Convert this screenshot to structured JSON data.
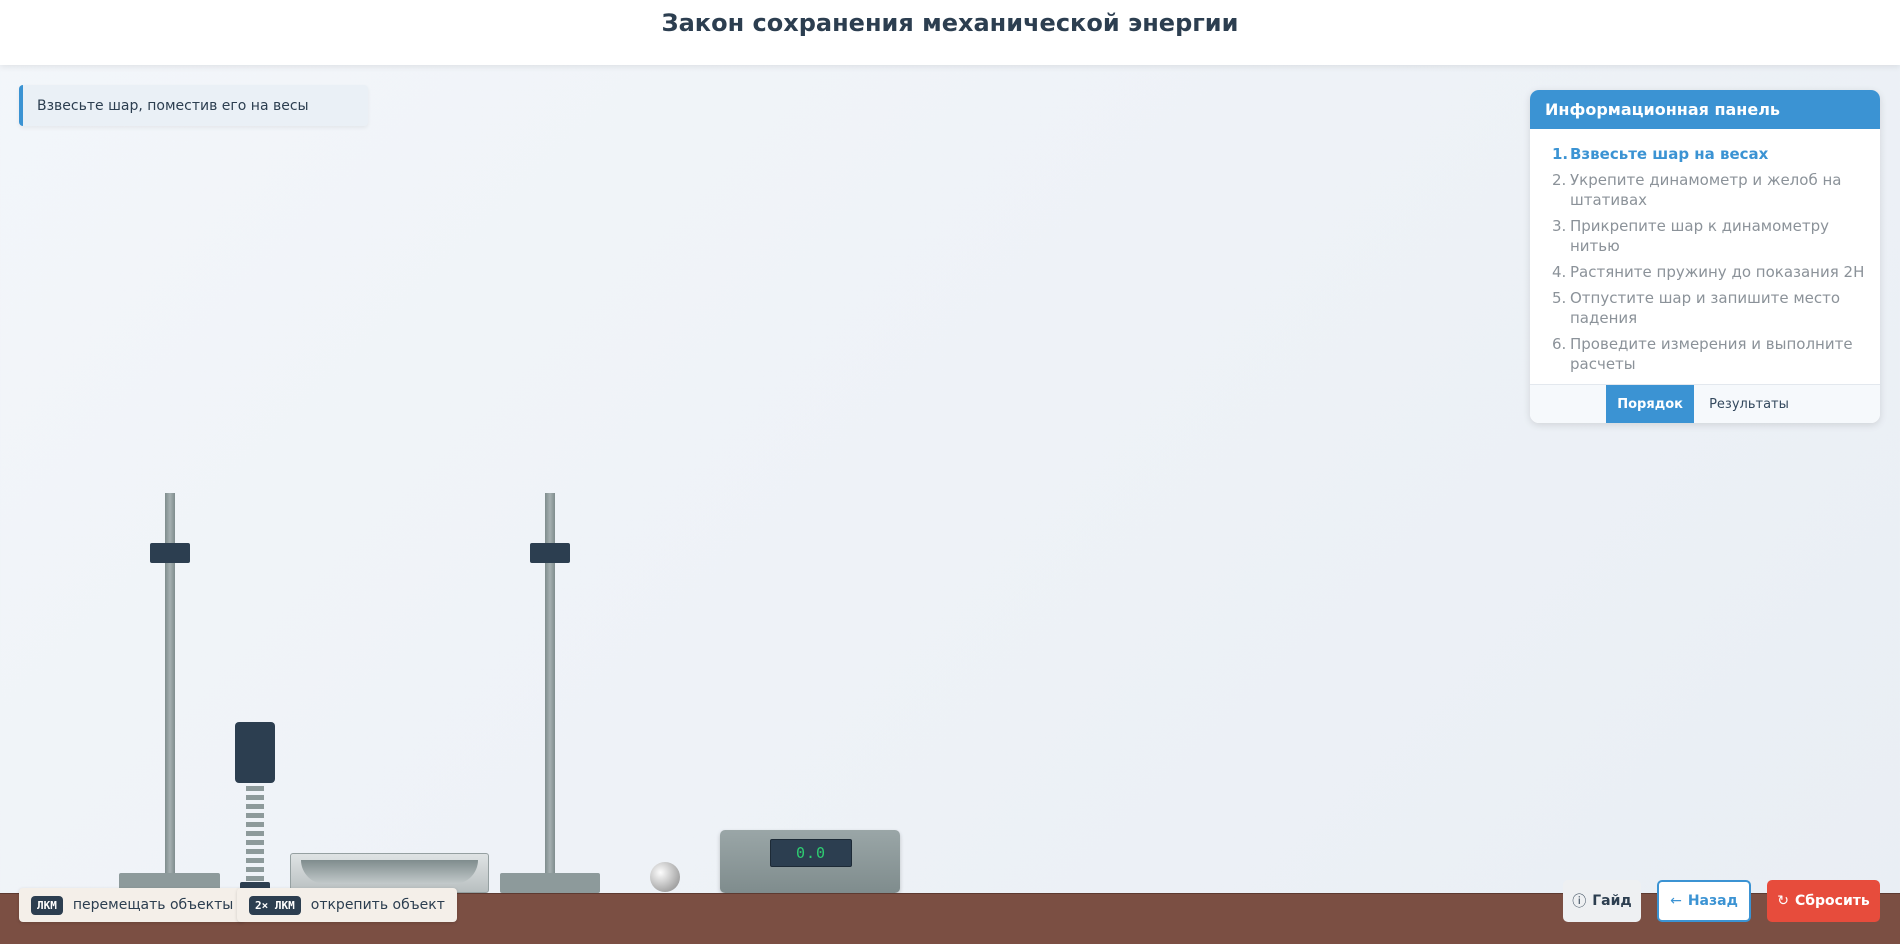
{
  "header": {
    "title": "Закон сохранения механической энергии"
  },
  "hint": {
    "text": "Взвесьте шар, поместив его на весы"
  },
  "info_panel": {
    "title": "Информационная панель",
    "steps": [
      {
        "num": "1.",
        "text": "Взвесьте шар на весах",
        "active": true
      },
      {
        "num": "2.",
        "text": "Укрепите динамометр и желоб на штативах",
        "active": false
      },
      {
        "num": "3.",
        "text": "Прикрепите шар к динамометру нитью",
        "active": false
      },
      {
        "num": "4.",
        "text": "Растяните пружину до показания 2Н",
        "active": false
      },
      {
        "num": "5.",
        "text": "Отпустите шар и запишите место падения",
        "active": false
      },
      {
        "num": "6.",
        "text": "Проведите измерения и выполните расчеты",
        "active": false
      }
    ],
    "tabs": [
      {
        "label": "Порядок",
        "active": true
      },
      {
        "label": "Результаты",
        "active": false
      }
    ]
  },
  "scale": {
    "reading": "0.0"
  },
  "hotkeys": [
    {
      "key": "ЛКМ",
      "label": "перемещать объекты"
    },
    {
      "key": "2× ЛКМ",
      "label": "открепить объект"
    }
  ],
  "buttons": {
    "guide": {
      "icon": "ⓘ",
      "label": "Гайд"
    },
    "back": {
      "icon": "←",
      "label": "Назад"
    },
    "reset": {
      "icon": "↻",
      "label": "Сбросить"
    }
  },
  "colors": {
    "accent": "#3b93d3",
    "danger": "#e74c3c",
    "dark": "#2c3e50",
    "floor": "#7b4f43"
  }
}
